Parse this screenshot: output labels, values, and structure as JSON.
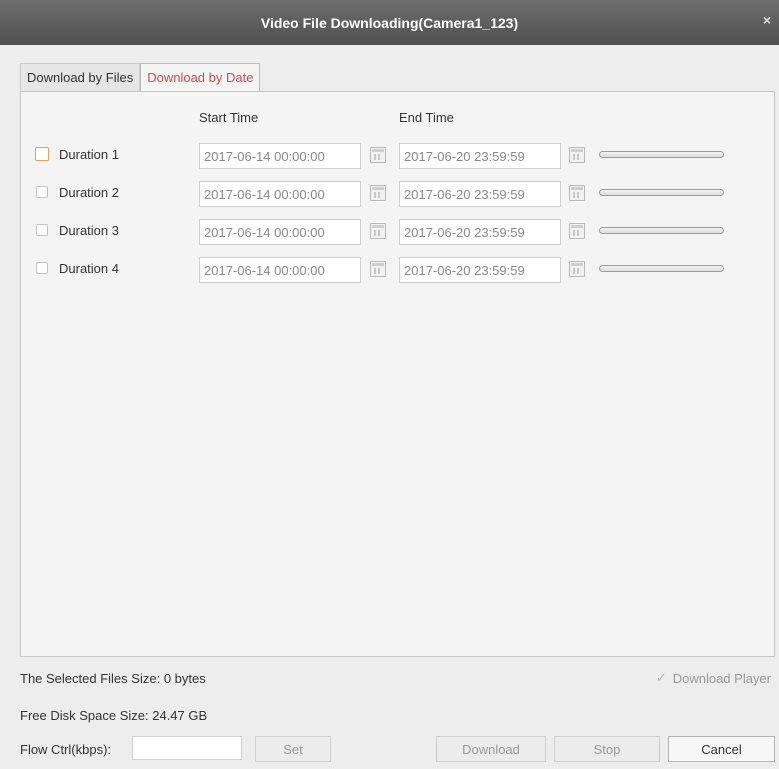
{
  "window": {
    "title": "Video File Downloading(Camera1_123)",
    "close_glyph": "×"
  },
  "tabs": [
    {
      "label": "Download by Files",
      "active": false
    },
    {
      "label": "Download by Date",
      "active": true
    }
  ],
  "columns": {
    "start": "Start Time",
    "end": "End Time"
  },
  "durations": [
    {
      "label": "Duration 1",
      "start": "2017-06-14 00:00:00",
      "end": "2017-06-20 23:59:59",
      "checked": false,
      "focused": true
    },
    {
      "label": "Duration 2",
      "start": "2017-06-14 00:00:00",
      "end": "2017-06-20 23:59:59",
      "checked": false,
      "focused": false
    },
    {
      "label": "Duration 3",
      "start": "2017-06-14 00:00:00",
      "end": "2017-06-20 23:59:59",
      "checked": false,
      "focused": false
    },
    {
      "label": "Duration 4",
      "start": "2017-06-14 00:00:00",
      "end": "2017-06-20 23:59:59",
      "checked": false,
      "focused": false
    }
  ],
  "footer": {
    "selected_size_label": "The Selected Files Size:",
    "selected_size_value": "0 bytes",
    "free_space_label": "Free Disk Space Size:",
    "free_space_value": "24.47 GB",
    "download_player_label": "Download Player",
    "download_player_checked": true,
    "flow_label": "Flow Ctrl(kbps):",
    "flow_value": "",
    "set_label": "Set",
    "download_label": "Download",
    "stop_label": "Stop",
    "cancel_label": "Cancel"
  },
  "colors": {
    "titlebar": "#5c5c5c",
    "active_tab_text": "#d64a4a",
    "focus_border": "#e0a060"
  }
}
